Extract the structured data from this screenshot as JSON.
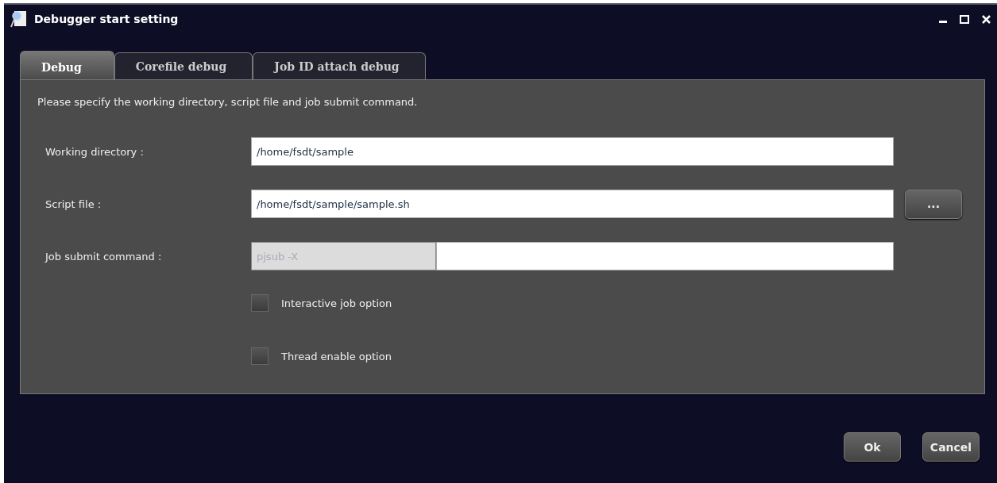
{
  "window": {
    "title": "Debugger start setting"
  },
  "tabs": [
    {
      "label": "Debug",
      "selected": true
    },
    {
      "label": "Corefile debug",
      "selected": false
    },
    {
      "label": "Job ID attach debug",
      "selected": false
    }
  ],
  "instruction": "Please specify the working directory, script file and job submit command.",
  "fields": [
    {
      "kind": "text",
      "label": "Working directory :",
      "value": "/home/fsdt/sample"
    },
    {
      "kind": "browse",
      "label": "Script file :",
      "value": "/home/fsdt/sample/sample.sh",
      "button": "..."
    },
    {
      "kind": "prefixed",
      "label": "Job submit command :",
      "prefix": {
        "value": "pjsub -X",
        "disabled": true
      }
    }
  ],
  "options": [
    {
      "label": "Interactive job option",
      "checked": false
    },
    {
      "label": "Thread enable option",
      "checked": false
    }
  ],
  "buttons": [
    "Ok",
    "Cancel"
  ]
}
